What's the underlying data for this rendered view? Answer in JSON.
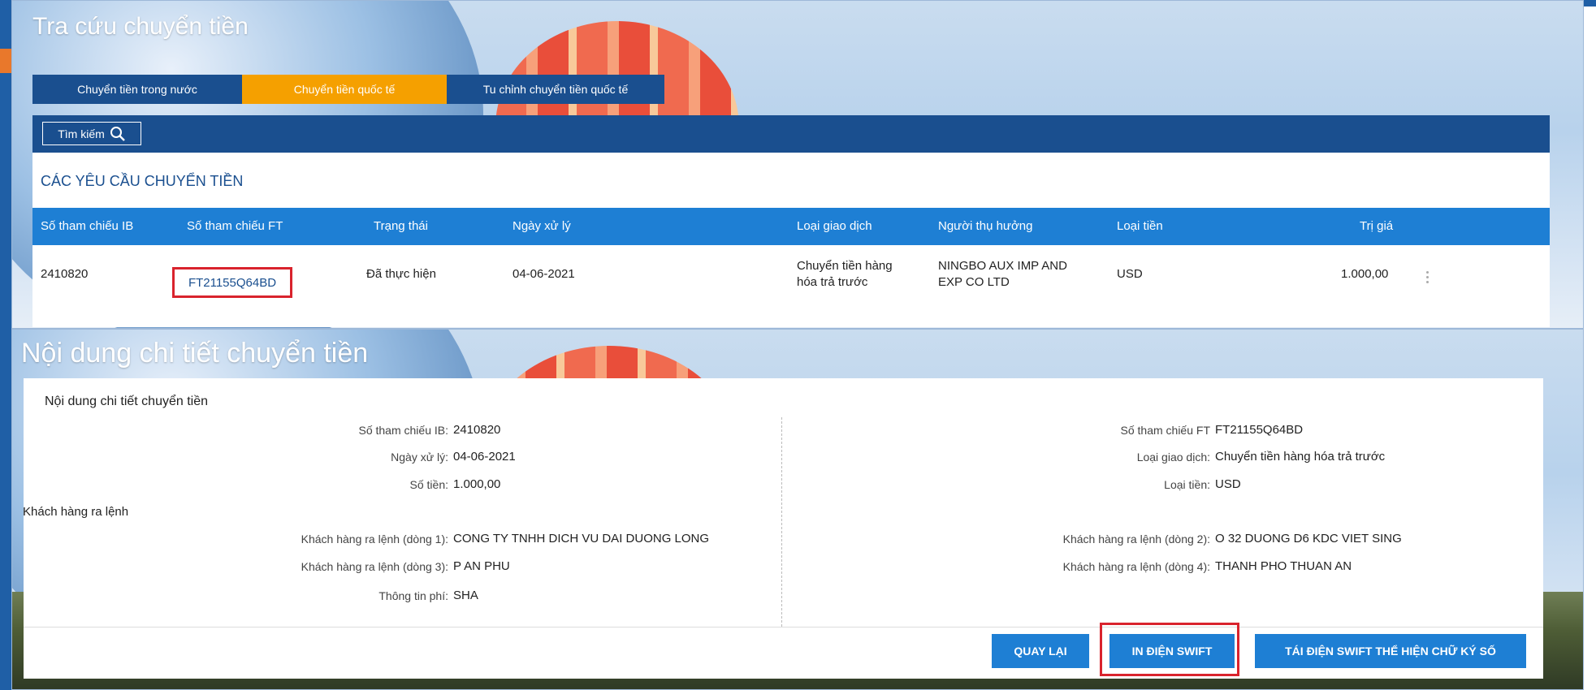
{
  "search_page": {
    "title": "Tra cứu chuyển tiền",
    "tabs": [
      "Chuyển tiền trong nước",
      "Chuyển tiền quốc tế",
      "Tu chỉnh chuyển tiền quốc tế"
    ],
    "search_label": "Tìm kiếm",
    "list_heading": "CÁC YÊU CẦU CHUYỂN TIỀN",
    "columns": [
      "Số tham chiếu IB",
      "Số tham chiếu FT",
      "Trạng thái",
      "Ngày xử lý",
      "Loại giao dịch",
      "Người thụ hưởng",
      "Loại tiền",
      "Trị giá"
    ],
    "row": {
      "ib_ref": "2410820",
      "ft_ref": "FT21155Q64BD",
      "status": "Đã thực hiện",
      "date": "04-06-2021",
      "type_line1": "Chuyển tiền hàng",
      "type_line2": "hóa trả trước",
      "beneficiary_line1": "NINGBO AUX IMP AND",
      "beneficiary_line2": "EXP CO LTD",
      "currency": "USD",
      "amount": "1.000,00"
    }
  },
  "detail_page": {
    "title": "Nội dung chi tiết chuyển tiền",
    "heading": "Nội dung chi tiết chuyển tiền",
    "left_fields": [
      {
        "label": "Số tham chiếu IB:",
        "value": "2410820"
      },
      {
        "label": "Ngày xử lý:",
        "value": "04-06-2021"
      },
      {
        "label": "Số tiền:",
        "value": "1.000,00"
      }
    ],
    "right_fields": [
      {
        "label": "Số tham chiếu FT",
        "value": "FT21155Q64BD"
      },
      {
        "label": "Loại giao dịch:",
        "value": "Chuyển tiền hàng hóa trả trước"
      },
      {
        "label": "Loại tiền:",
        "value": "USD"
      }
    ],
    "group_label": "Khách hàng ra lệnh",
    "customer_left": [
      {
        "label": "Khách hàng ra lệnh (dòng 1):",
        "value": "CONG TY TNHH DICH VU DAI DUONG LONG"
      },
      {
        "label": "Khách hàng ra lệnh (dòng 3):",
        "value": "P AN PHU"
      },
      {
        "label": "Thông tin phí:",
        "value": "SHA"
      }
    ],
    "customer_right": [
      {
        "label": "Khách hàng ra lệnh (dòng 2):",
        "value": "O 32 DUONG D6 KDC VIET SING"
      },
      {
        "label": "Khách hàng ra lệnh (dòng 4):",
        "value": "THANH PHO THUAN AN"
      }
    ],
    "buttons": {
      "back": "QUAY LẠI",
      "print_swift": "IN ĐIỆN SWIFT",
      "resend_swift": "TÁI ĐIỆN SWIFT THỂ HIỆN CHỮ KÝ SỐ"
    }
  },
  "colors": {
    "primary": "#1a4f8f",
    "table_header": "#1e7fd4",
    "active_tab": "#f5a000",
    "highlight": "#d9232d"
  }
}
